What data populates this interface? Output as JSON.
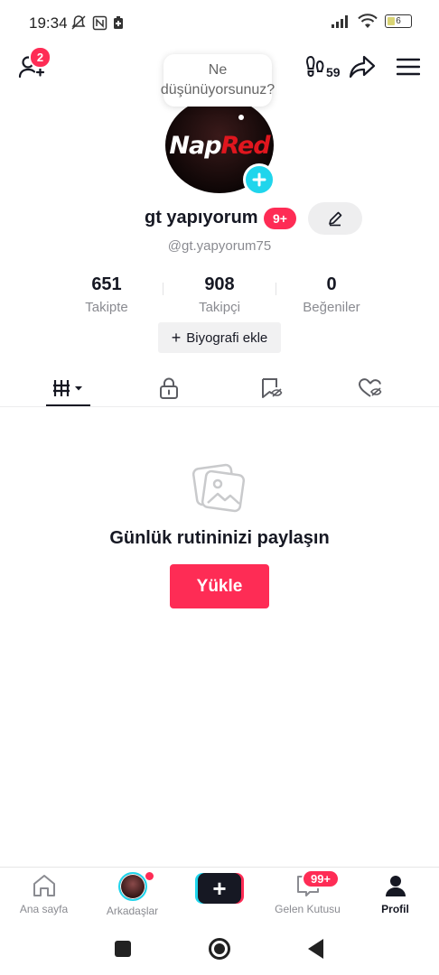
{
  "status_bar": {
    "time": "19:34",
    "battery": "6"
  },
  "top_bar": {
    "friend_requests_badge": "2",
    "footprint_count": "59"
  },
  "profile": {
    "note_bubble": "Ne düşünüyorsunuz?",
    "avatar_text_white": "Nap",
    "avatar_text_red": "Red",
    "username": "gt yapıyorum",
    "username_badge": "9+",
    "handle": "@gt.yapyorum75",
    "stats": [
      {
        "value": "651",
        "label": "Takipte"
      },
      {
        "value": "908",
        "label": "Takipçi"
      },
      {
        "value": "0",
        "label": "Beğeniler"
      }
    ],
    "bio_button": "Biyografi ekle",
    "bio_button_plus": "+"
  },
  "tabs": [
    {
      "icon": "grid-icon",
      "active": true
    },
    {
      "icon": "lock-icon",
      "active": false
    },
    {
      "icon": "bookmark-hidden-icon",
      "active": false
    },
    {
      "icon": "liked-hidden-icon",
      "active": false
    }
  ],
  "empty_state": {
    "title": "Günlük rutininizi paylaşın",
    "button": "Yükle"
  },
  "bottom_nav": {
    "home": "Ana sayfa",
    "friends": "Arkadaşlar",
    "create": "+",
    "inbox": "Gelen Kutusu",
    "inbox_badge": "99+",
    "profile": "Profil"
  },
  "colors": {
    "accent": "#fe2c55",
    "cyan": "#20d5ec",
    "text": "#161823",
    "muted": "#8a8b91"
  }
}
